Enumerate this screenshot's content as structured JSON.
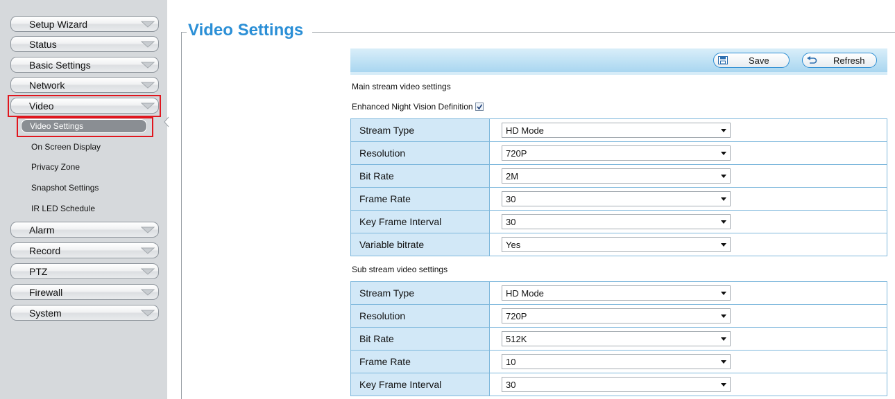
{
  "sidebar": {
    "menu": [
      {
        "label": "Setup Wizard"
      },
      {
        "label": "Status"
      },
      {
        "label": "Basic Settings"
      },
      {
        "label": "Network"
      },
      {
        "label": "Video"
      },
      {
        "label": "Alarm"
      },
      {
        "label": "Record"
      },
      {
        "label": "PTZ"
      },
      {
        "label": "Firewall"
      },
      {
        "label": "System"
      }
    ],
    "video_submenu": [
      {
        "label": "Video Settings"
      },
      {
        "label": "On Screen Display"
      },
      {
        "label": "Privacy Zone"
      },
      {
        "label": "Snapshot Settings"
      },
      {
        "label": "IR LED Schedule"
      }
    ]
  },
  "page": {
    "title": "Video Settings"
  },
  "toolbar": {
    "save_label": "Save",
    "refresh_label": "Refresh"
  },
  "main_stream": {
    "heading": "Main stream video settings",
    "night_vision_label": "Enhanced Night Vision Definition",
    "night_vision_checked": true,
    "rows": [
      {
        "label": "Stream Type",
        "value": "HD Mode"
      },
      {
        "label": "Resolution",
        "value": "720P"
      },
      {
        "label": "Bit Rate",
        "value": "2M"
      },
      {
        "label": "Frame Rate",
        "value": "30"
      },
      {
        "label": "Key Frame Interval",
        "value": "30"
      },
      {
        "label": "Variable bitrate",
        "value": "Yes"
      }
    ]
  },
  "sub_stream": {
    "heading": "Sub stream video settings",
    "rows": [
      {
        "label": "Stream Type",
        "value": "HD Mode"
      },
      {
        "label": "Resolution",
        "value": "720P"
      },
      {
        "label": "Bit Rate",
        "value": "512K"
      },
      {
        "label": "Frame Rate",
        "value": "10"
      },
      {
        "label": "Key Frame Interval",
        "value": "30"
      }
    ]
  },
  "colors": {
    "accent": "#2b8fd6",
    "highlight": "#e0161e",
    "table_label_bg": "#d2e8f7"
  }
}
